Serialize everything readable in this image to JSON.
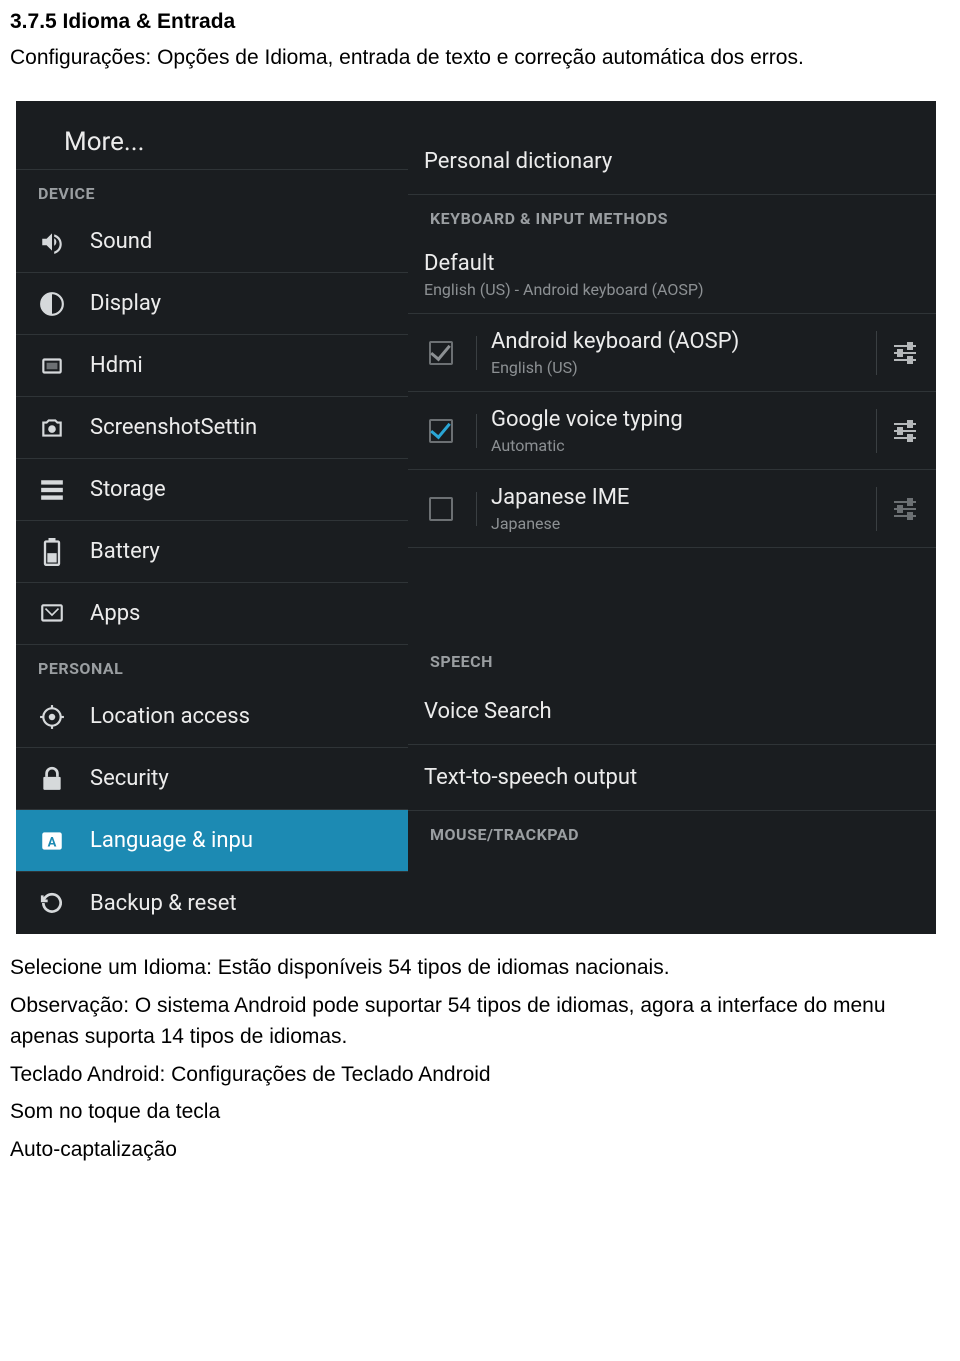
{
  "doc": {
    "title": "3.7.5  Idioma & Entrada",
    "subtitle": "Configurações: Opções de Idioma, entrada de texto e correção automática dos erros.",
    "p1": "Selecione um Idioma: Estão disponíveis 54 tipos de idiomas nacionais.",
    "p2": "Observação: O sistema Android pode suportar 54 tipos de idiomas, agora a interface do menu apenas suporta 14 tipos de idiomas.",
    "p3": "Teclado Android: Configurações de Teclado Android",
    "p4": "Som no toque da tecla",
    "p5": "Auto-captalização"
  },
  "left": {
    "more": "More...",
    "catDevice": "DEVICE",
    "sound": "Sound",
    "display": "Display",
    "hdmi": "Hdmi",
    "screenshot": "ScreenshotSettin",
    "storage": "Storage",
    "battery": "Battery",
    "apps": "Apps",
    "catPersonal": "PERSONAL",
    "location": "Location access",
    "security": "Security",
    "language": "Language & inpu",
    "backup": "Backup & reset"
  },
  "right": {
    "personalDict": "Personal dictionary",
    "catKeyboard": "KEYBOARD & INPUT METHODS",
    "defaultTitle": "Default",
    "defaultSub": "English (US) - Android keyboard (AOSP)",
    "aospTitle": "Android keyboard (AOSP)",
    "aospSub": "English (US)",
    "gvoiceTitle": "Google voice typing",
    "gvoiceSub": "Automatic",
    "jimeTitle": "Japanese IME",
    "jimeSub": "Japanese",
    "catSpeech": "SPEECH",
    "voiceSearch": "Voice Search",
    "tts": "Text-to-speech output",
    "catMouse": "MOUSE/TRACKPAD"
  }
}
